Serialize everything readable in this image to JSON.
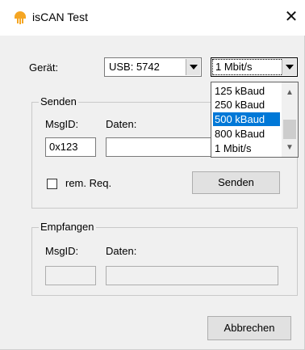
{
  "window": {
    "title": "isCAN Test",
    "close_glyph": "✕",
    "icon": "iscan-app-icon",
    "accent_color": "#f5a623"
  },
  "device": {
    "label": "Gerät:",
    "selected": "USB: 5742"
  },
  "baud": {
    "selected": "1 Mbit/s",
    "options": [
      "125 kBaud",
      "250 kBaud",
      "500 kBaud",
      "800 kBaud",
      "1 Mbit/s"
    ],
    "highlighted": "500 kBaud"
  },
  "senden_group": {
    "title": "Senden",
    "msgid_label": "MsgID:",
    "daten_label": "Daten:",
    "msgid_value": "0x123",
    "daten_value": "",
    "rem_req_label": "rem. Req.",
    "send_button": "Senden"
  },
  "empfangen_group": {
    "title": "Empfangen",
    "msgid_label": "MsgID:",
    "daten_label": "Daten:",
    "msgid_value": "",
    "daten_value": ""
  },
  "cancel_button": "Abbrechen"
}
